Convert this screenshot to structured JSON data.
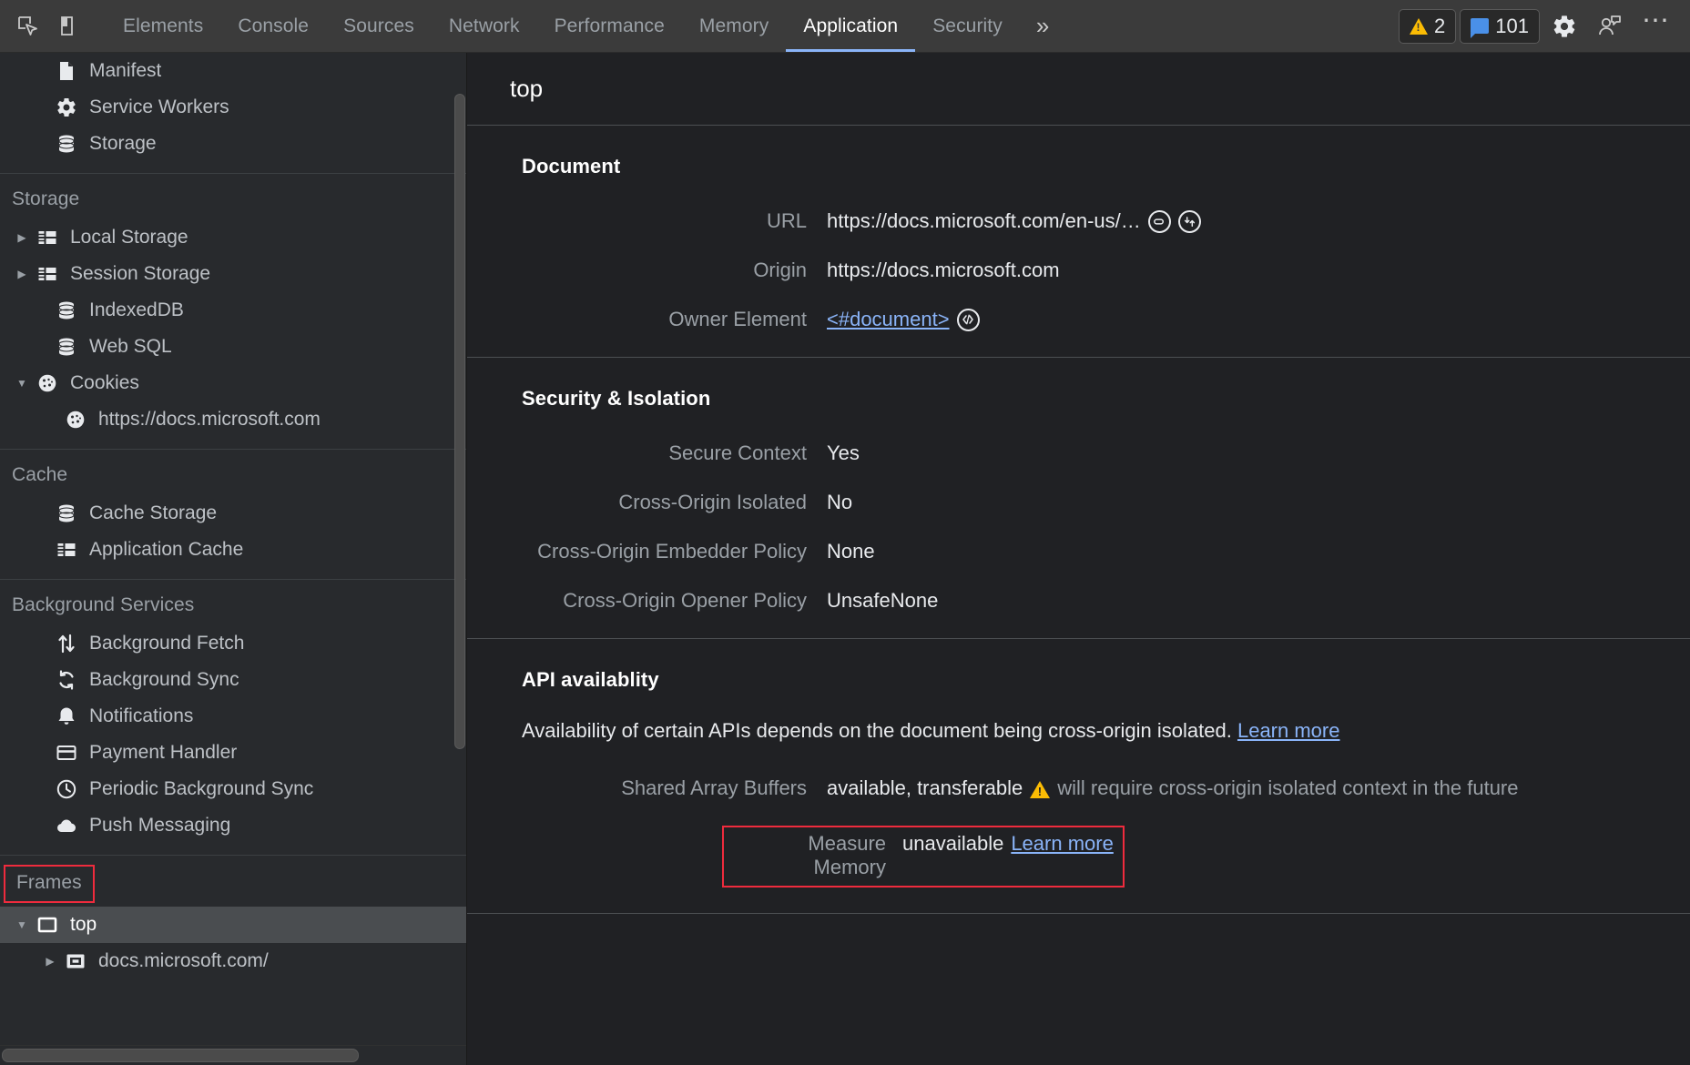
{
  "toolbar": {
    "inspect_icon": "inspect-element-icon",
    "device_icon": "device-toolbar-icon",
    "tabs": [
      {
        "label": "Elements",
        "active": false
      },
      {
        "label": "Console",
        "active": false
      },
      {
        "label": "Sources",
        "active": false
      },
      {
        "label": "Network",
        "active": false
      },
      {
        "label": "Performance",
        "active": false
      },
      {
        "label": "Memory",
        "active": false
      },
      {
        "label": "Application",
        "active": true
      },
      {
        "label": "Security",
        "active": false
      }
    ],
    "more_tabs": "»",
    "warning_count": "2",
    "message_count": "101",
    "settings_icon": "gear-icon",
    "feedback_icon": "feedback-icon",
    "more_options": "⋯"
  },
  "sidebar": {
    "groups": [
      {
        "header": null,
        "boxed": false,
        "items": [
          {
            "label": "Manifest",
            "icon": "manifest-file-icon",
            "arrow": "none",
            "indent": 1,
            "selected": false
          },
          {
            "label": "Service Workers",
            "icon": "gear-icon",
            "arrow": "none",
            "indent": 1,
            "selected": false
          },
          {
            "label": "Storage",
            "icon": "database-icon",
            "arrow": "none",
            "indent": 1,
            "selected": false
          }
        ]
      },
      {
        "header": "Storage",
        "boxed": false,
        "items": [
          {
            "label": "Local Storage",
            "icon": "table-icon",
            "arrow": "collapsed",
            "indent": 0,
            "selected": false
          },
          {
            "label": "Session Storage",
            "icon": "table-icon",
            "arrow": "collapsed",
            "indent": 0,
            "selected": false
          },
          {
            "label": "IndexedDB",
            "icon": "database-icon",
            "arrow": "none",
            "indent": 1,
            "selected": false
          },
          {
            "label": "Web SQL",
            "icon": "database-icon",
            "arrow": "none",
            "indent": 1,
            "selected": false
          },
          {
            "label": "Cookies",
            "icon": "cookie-icon",
            "arrow": "expanded",
            "indent": 0,
            "selected": false
          },
          {
            "label": "https://docs.microsoft.com",
            "icon": "cookie-icon",
            "arrow": "none",
            "indent": 2,
            "selected": false
          }
        ]
      },
      {
        "header": "Cache",
        "boxed": false,
        "items": [
          {
            "label": "Cache Storage",
            "icon": "database-icon",
            "arrow": "none",
            "indent": 1,
            "selected": false
          },
          {
            "label": "Application Cache",
            "icon": "table-icon",
            "arrow": "none",
            "indent": 1,
            "selected": false
          }
        ]
      },
      {
        "header": "Background Services",
        "boxed": false,
        "items": [
          {
            "label": "Background Fetch",
            "icon": "fetch-arrows-icon",
            "arrow": "none",
            "indent": 1,
            "selected": false
          },
          {
            "label": "Background Sync",
            "icon": "sync-icon",
            "arrow": "none",
            "indent": 1,
            "selected": false
          },
          {
            "label": "Notifications",
            "icon": "bell-icon",
            "arrow": "none",
            "indent": 1,
            "selected": false
          },
          {
            "label": "Payment Handler",
            "icon": "credit-card-icon",
            "arrow": "none",
            "indent": 1,
            "selected": false
          },
          {
            "label": "Periodic Background Sync",
            "icon": "clock-icon",
            "arrow": "none",
            "indent": 1,
            "selected": false
          },
          {
            "label": "Push Messaging",
            "icon": "cloud-icon",
            "arrow": "none",
            "indent": 1,
            "selected": false
          }
        ]
      },
      {
        "header": "Frames",
        "boxed": true,
        "items": [
          {
            "label": "top",
            "icon": "frame-icon",
            "arrow": "expanded",
            "indent": 0,
            "selected": true
          },
          {
            "label": "docs.microsoft.com/",
            "icon": "iframe-icon",
            "arrow": "collapsed",
            "indent": 2,
            "selected": false
          }
        ]
      }
    ]
  },
  "main": {
    "frame_title": "top",
    "document": {
      "title": "Document",
      "rows": [
        {
          "key": "URL",
          "value": "https://docs.microsoft.com/en-us/…",
          "icons": [
            "open-in-new-tab-icon",
            "reveal-in-network-icon"
          ],
          "link": false
        },
        {
          "key": "Origin",
          "value": "https://docs.microsoft.com",
          "icons": [],
          "link": false
        },
        {
          "key": "Owner Element",
          "value": "<#document>",
          "icons": [
            "code-icon"
          ],
          "link": true
        }
      ]
    },
    "security": {
      "title": "Security & Isolation",
      "rows": [
        {
          "key": "Secure Context",
          "value": "Yes"
        },
        {
          "key": "Cross-Origin Isolated",
          "value": "No"
        },
        {
          "key": "Cross-Origin Embedder Policy",
          "value": "None"
        },
        {
          "key": "Cross-Origin Opener Policy",
          "value": "UnsafeNone"
        }
      ]
    },
    "api": {
      "title": "API availablity",
      "description": "Availability of certain APIs depends on the document being cross-origin isolated.",
      "description_link": "Learn more",
      "shared_array_buffers": {
        "key": "Shared Array Buffers",
        "value": "available, transferable",
        "warning_icon": "warning-triangle-icon",
        "warning_text": "will require cross-origin isolated context in the future"
      },
      "measure_memory": {
        "key": "Measure Memory",
        "value": "unavailable",
        "link": "Learn more"
      }
    }
  },
  "colors": {
    "accent_link": "#8ab4f8",
    "highlight_box": "#ef2b3d",
    "warning": "#fbbc04",
    "panel_bg": "#202124",
    "sidebar_bg": "#282a2d",
    "toolbar_bg": "#3b3b3b"
  }
}
